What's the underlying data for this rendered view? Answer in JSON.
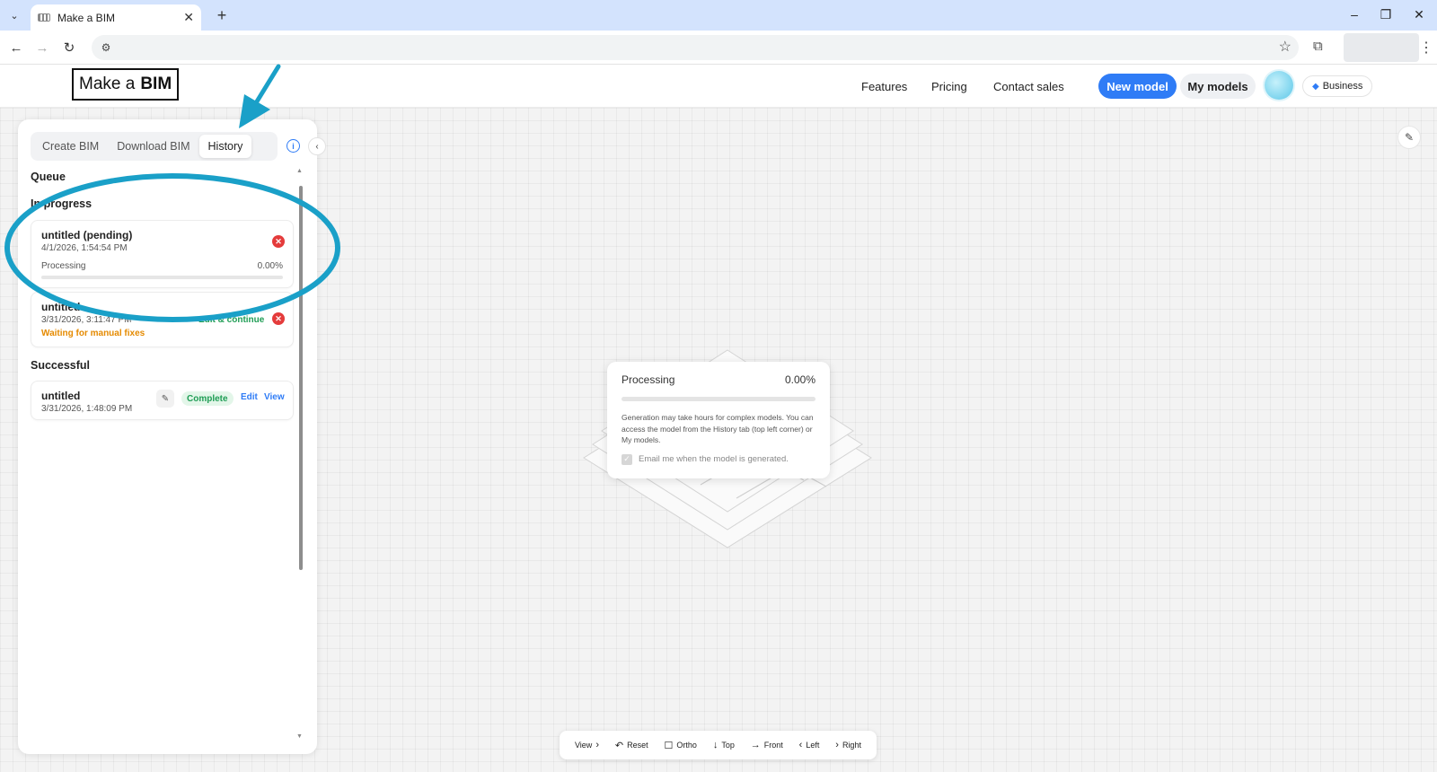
{
  "browser": {
    "tab_title": "Make a BIM"
  },
  "header": {
    "logo_prefix": "Make a",
    "logo_bold": "BIM",
    "nav": [
      "Features",
      "Pricing",
      "Contact sales"
    ],
    "new_model_label": "New model",
    "my_models_label": "My models",
    "plan_badge": "Business"
  },
  "panel": {
    "tabs": [
      "Create BIM",
      "Download BIM",
      "History"
    ],
    "active_tab": "History",
    "sections": {
      "queue": "Queue",
      "in_progress": "In progress",
      "successful": "Successful"
    },
    "in_progress": [
      {
        "name": "untitled (pending)",
        "date": "4/1/2026, 1:54:54 PM",
        "status_label": "Processing",
        "progress_text": "0.00%",
        "progress": 0.0
      },
      {
        "name": "untitled",
        "date": "3/31/2026, 3:11:47 PM",
        "action": "Edit & continue",
        "status_note": "Waiting for manual fixes"
      }
    ],
    "successful": [
      {
        "name": "untitled",
        "date": "3/31/2026, 1:48:09 PM",
        "badge": "Complete",
        "edit_label": "Edit",
        "view_label": "View"
      }
    ]
  },
  "processing_popup": {
    "title": "Processing",
    "percent": "0.00%",
    "progress": 0.0,
    "note": "Generation may take hours for complex models. You can access the model from the History tab (top left corner) or My models.",
    "email_label": "Email me when the model is generated.",
    "email_checked": true
  },
  "view_toolbar": {
    "items": [
      "View",
      "Reset",
      "Ortho",
      "Top",
      "Front",
      "Left",
      "Right"
    ]
  },
  "colors": {
    "accent": "#2f7cf6",
    "annotation": "#1aa0c8",
    "success": "#1f9d55",
    "warning": "#e58a00",
    "danger": "#e43b3b"
  }
}
